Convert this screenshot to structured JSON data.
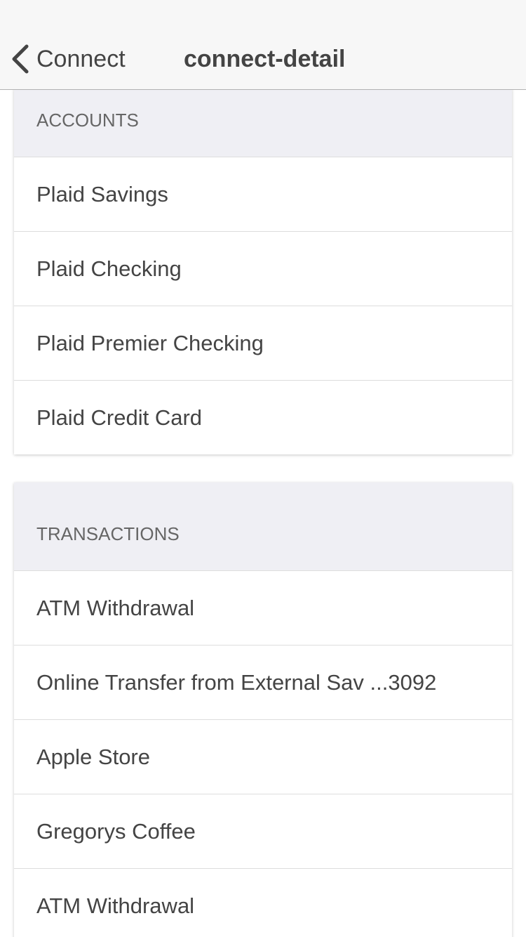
{
  "navbar": {
    "back_label": "Connect",
    "title": "connect-detail"
  },
  "accounts": {
    "header": "ACCOUNTS",
    "items": [
      {
        "label": "Plaid Savings"
      },
      {
        "label": "Plaid Checking"
      },
      {
        "label": "Plaid Premier Checking"
      },
      {
        "label": "Plaid Credit Card"
      }
    ]
  },
  "transactions": {
    "header": "TRANSACTIONS",
    "items": [
      {
        "label": "ATM Withdrawal"
      },
      {
        "label": "Online Transfer from External Sav ...3092"
      },
      {
        "label": "Apple Store"
      },
      {
        "label": "Gregorys Coffee"
      },
      {
        "label": "ATM Withdrawal"
      }
    ]
  }
}
